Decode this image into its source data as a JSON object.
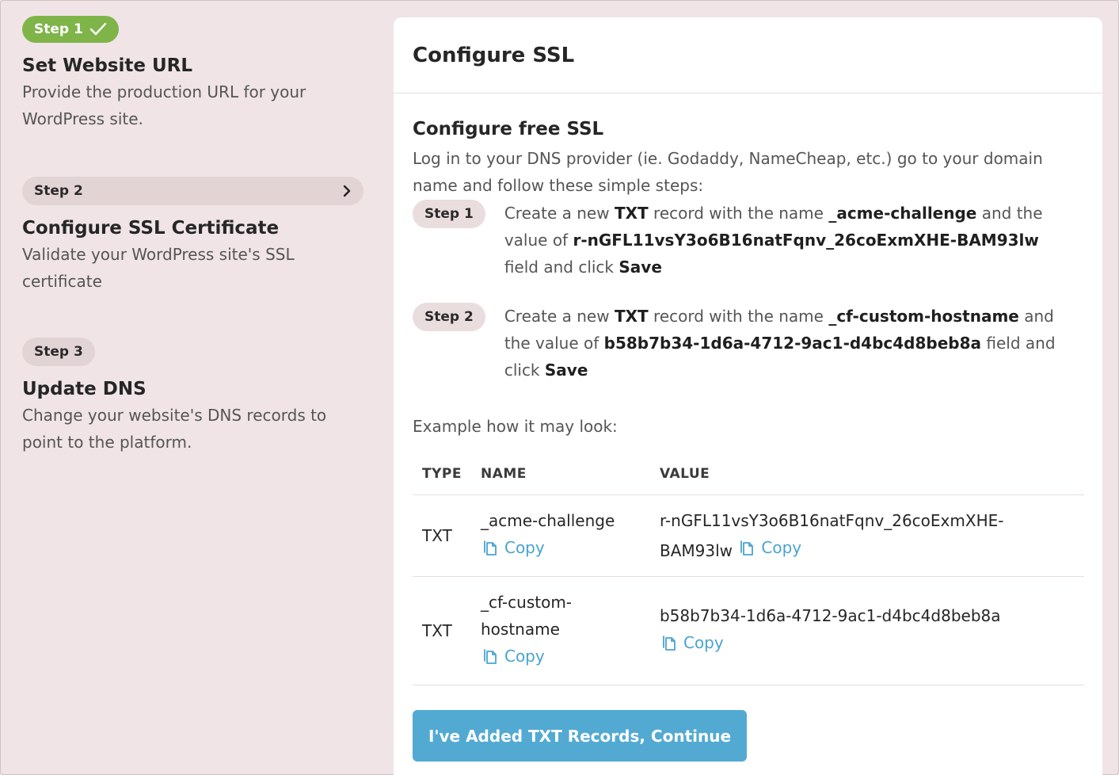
{
  "sidebar": {
    "step1": {
      "badge": "Step 1",
      "title": "Set Website URL",
      "description": "Provide the production URL for your WordPress site."
    },
    "step2": {
      "badge": "Step 2",
      "title": "Configure SSL Certificate",
      "description": "Validate your WordPress site's SSL certificate"
    },
    "step3": {
      "badge": "Step 3",
      "title": "Update DNS",
      "description": "Change your website's DNS records to point to the platform."
    }
  },
  "card": {
    "title": "Configure SSL",
    "section_title": "Configure free SSL",
    "intro": "Log in to your DNS provider (ie. Godaddy, NameCheap, etc.) go to your domain name and follow these simple steps:",
    "steps": [
      {
        "badge": "Step 1",
        "p1": "Create a new ",
        "record_type": "TXT",
        "p2": " record with the name ",
        "record_name": "_acme-challenge",
        "p3": " and the value of ",
        "record_value": "r-nGFL11vsY3o6B16natFqnv_26coExmXHE-BAM93lw",
        "p4": " field and click ",
        "action": "Save"
      },
      {
        "badge": "Step 2",
        "p1": "Create a new ",
        "record_type": "TXT",
        "p2": " record with the name ",
        "record_name": "_cf-custom-hostname",
        "p3": " and the value of ",
        "record_value": "b58b7b34-1d6a-4712-9ac1-d4bc4d8beb8a",
        "p4": " field and click ",
        "action": "Save"
      }
    ],
    "example_label": "Example how it may look:",
    "table": {
      "headers": [
        "TYPE",
        "NAME",
        "VALUE"
      ],
      "rows": [
        {
          "type": "TXT",
          "name": "_acme-challenge",
          "value": "r-nGFL11vsY3o6B16natFqnv_26coExmXHE-BAM93lw"
        },
        {
          "type": "TXT",
          "name": "_cf-custom-hostname",
          "value": "b58b7b34-1d6a-4712-9ac1-d4bc4d8beb8a"
        }
      ],
      "copy_label": "Copy"
    },
    "continue_label": "I've Added TXT Records, Continue"
  },
  "colors": {
    "accent": "#52aad3",
    "link": "#4aa3cf",
    "done": "#7fb449",
    "pill": "#e2d3d5",
    "background": "#f0e4e6"
  },
  "icons": {
    "done": "check-icon",
    "active": "chevron-right-icon",
    "copy": "copy-icon"
  }
}
